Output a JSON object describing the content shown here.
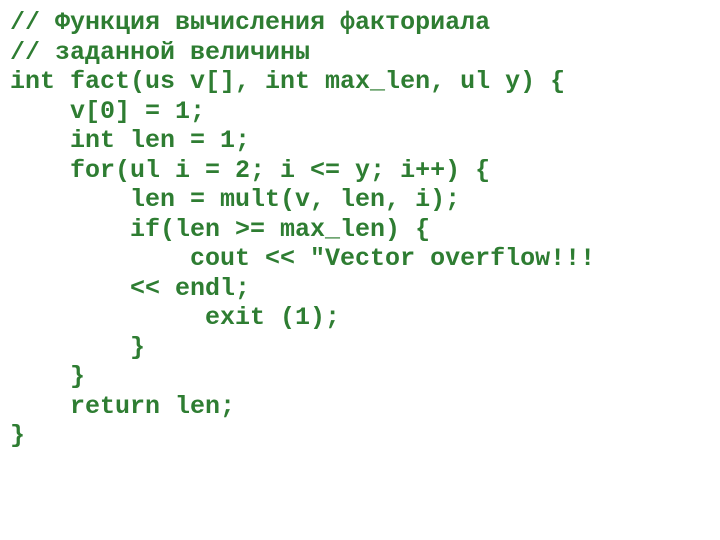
{
  "code": {
    "lines": [
      "// Функция вычисления факториала",
      "// заданной величины",
      "int fact(us v[], int max_len, ul y) {",
      "    v[0] = 1;",
      "    int len = 1;",
      "    for(ul i = 2; i <= y; i++) {",
      "        len = mult(v, len, i);",
      "        if(len >= max_len) {",
      "            cout << \"Vector overflow!!!",
      "        << endl;",
      "             exit (1);",
      "        }",
      "    }",
      "    return len;",
      "}"
    ]
  }
}
